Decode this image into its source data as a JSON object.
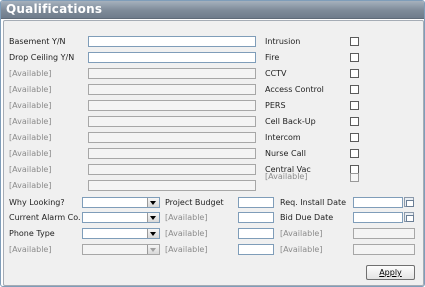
{
  "title": "Qualifications",
  "left_fields": [
    {
      "label": "Basement Y/N",
      "value": "",
      "enabled": true
    },
    {
      "label": "Drop Ceiling Y/N",
      "value": "",
      "enabled": true
    },
    {
      "label": "[Available]",
      "value": "",
      "enabled": false
    },
    {
      "label": "[Available]",
      "value": "",
      "enabled": false
    },
    {
      "label": "[Available]",
      "value": "",
      "enabled": false
    },
    {
      "label": "[Available]",
      "value": "",
      "enabled": false
    },
    {
      "label": "[Available]",
      "value": "",
      "enabled": false
    },
    {
      "label": "[Available]",
      "value": "",
      "enabled": false
    },
    {
      "label": "[Available]",
      "value": "",
      "enabled": false
    },
    {
      "label": "[Available]",
      "value": "",
      "enabled": false
    }
  ],
  "checkboxes": [
    {
      "label": "Intrusion",
      "checked": false,
      "enabled": true
    },
    {
      "label": "Fire",
      "checked": false,
      "enabled": true
    },
    {
      "label": "CCTV",
      "checked": false,
      "enabled": true
    },
    {
      "label": "Access Control",
      "checked": false,
      "enabled": true
    },
    {
      "label": "PERS",
      "checked": false,
      "enabled": true
    },
    {
      "label": "Cell Back-Up",
      "checked": false,
      "enabled": true
    },
    {
      "label": "Intercom",
      "checked": false,
      "enabled": true
    },
    {
      "label": "Nurse Call",
      "checked": false,
      "enabled": true
    },
    {
      "label": "Central Vac",
      "checked": false,
      "enabled": true
    },
    {
      "label": "[Available]",
      "checked": false,
      "enabled": false
    }
  ],
  "combos": [
    {
      "label": "Why Looking?",
      "value": "",
      "enabled": true
    },
    {
      "label": "Current Alarm Co.",
      "value": "",
      "enabled": true
    },
    {
      "label": "Phone Type",
      "value": "",
      "enabled": true
    },
    {
      "label": "[Available]",
      "value": "",
      "enabled": false
    }
  ],
  "mid_fields": [
    {
      "label": "Project Budget",
      "value": "",
      "enabled": true
    },
    {
      "label": "[Available]",
      "value": "",
      "enabled": false
    },
    {
      "label": "[Available]",
      "value": "",
      "enabled": false
    },
    {
      "label": "[Available]",
      "value": "",
      "enabled": false
    }
  ],
  "date_fields": [
    {
      "label": "Req. Install Date",
      "value": "",
      "enabled": true
    },
    {
      "label": "Bid Due Date",
      "value": "",
      "enabled": true
    },
    {
      "label": "[Available]",
      "value": "",
      "enabled": false
    },
    {
      "label": "[Available]",
      "value": "",
      "enabled": false
    }
  ],
  "apply_label": "Apply"
}
